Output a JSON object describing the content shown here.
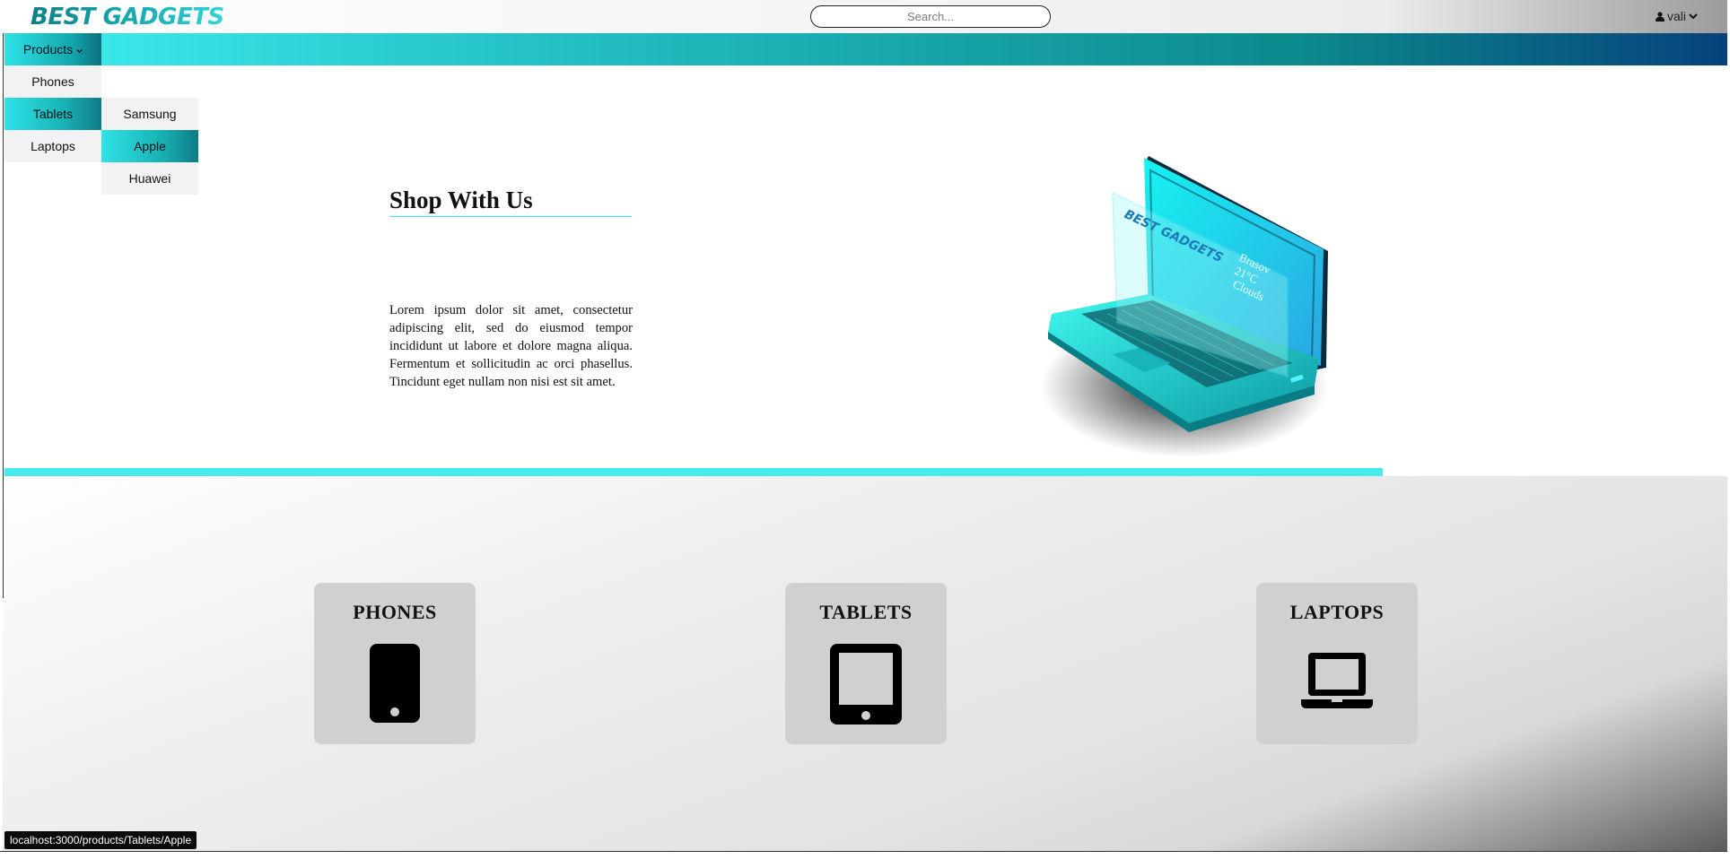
{
  "header": {
    "logo": "BEST GADGETS",
    "search_placeholder": "Search...",
    "user_name": "vali"
  },
  "nav": {
    "products_label": "Products",
    "categories": [
      "Phones",
      "Tablets",
      "Laptops"
    ],
    "active_category": "Tablets",
    "brands": [
      "Samsung",
      "Apple",
      "Huawei"
    ],
    "active_brand": "Apple"
  },
  "hero": {
    "title": "Shop With Us",
    "text": "Lorem ipsum dolor sit amet, consectetur adipiscing elit, sed do eiusmod tempor incididunt ut labore et dolore magna aliqua. Fermentum et sollicitudin ac orci phasellus. Tincidunt eget nullam non nisi est sit amet.",
    "laptop_screen": {
      "brand": "BEST GADGETS",
      "city": "Brasov",
      "temp": "21°C",
      "weather": "Clouds"
    }
  },
  "categories_cards": [
    {
      "title": "PHONES",
      "icon": "phone-icon"
    },
    {
      "title": "TABLETS",
      "icon": "tablet-icon"
    },
    {
      "title": "LAPTOPS",
      "icon": "laptop-icon"
    }
  ],
  "status_bar": {
    "url": "localhost:3000/products/Tablets/Apple"
  },
  "colors": {
    "accent": "#47eaed",
    "teal_dark": "#0c8a8c",
    "navy": "#06427c"
  }
}
